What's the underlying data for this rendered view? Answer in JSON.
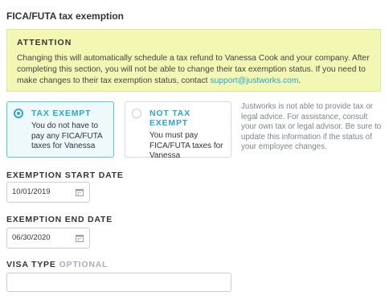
{
  "section_title": "FICA/FUTA tax exemption",
  "attention": {
    "title": "ATTENTION",
    "body": "Changing this will automatically schedule a tax refund to Vanessa Cook and your company. After completing this section, you will not be able to change their tax exemption status. If you need to make changes to their tax exemption status, contact ",
    "link": "support@justworks.com",
    "body_end": "."
  },
  "options": [
    {
      "title": "TAX EXEMPT",
      "desc": "You do not have to pay any FICA/FUTA taxes for Vanessa",
      "selected": true
    },
    {
      "title": "NOT TAX EXEMPT",
      "desc": "You must pay FICA/FUTA taxes for Vanessa",
      "selected": false
    }
  ],
  "side_note": "Justworks is not able to provide tax or legal advice. For assistance, consult your own tax or legal advisor. Be sure to update this information if the status of your employee changes.",
  "start_date": {
    "label": "EXEMPTION START DATE",
    "value": "10/01/2019"
  },
  "end_date": {
    "label": "EXEMPTION END DATE",
    "value": "06/30/2020"
  },
  "visa_type": {
    "label": "VISA TYPE",
    "optional": "OPTIONAL",
    "value": ""
  },
  "colors": {
    "accent": "#2aa7d0",
    "attention_bg": "#f2f8b4",
    "link": "#2a9fd6"
  }
}
